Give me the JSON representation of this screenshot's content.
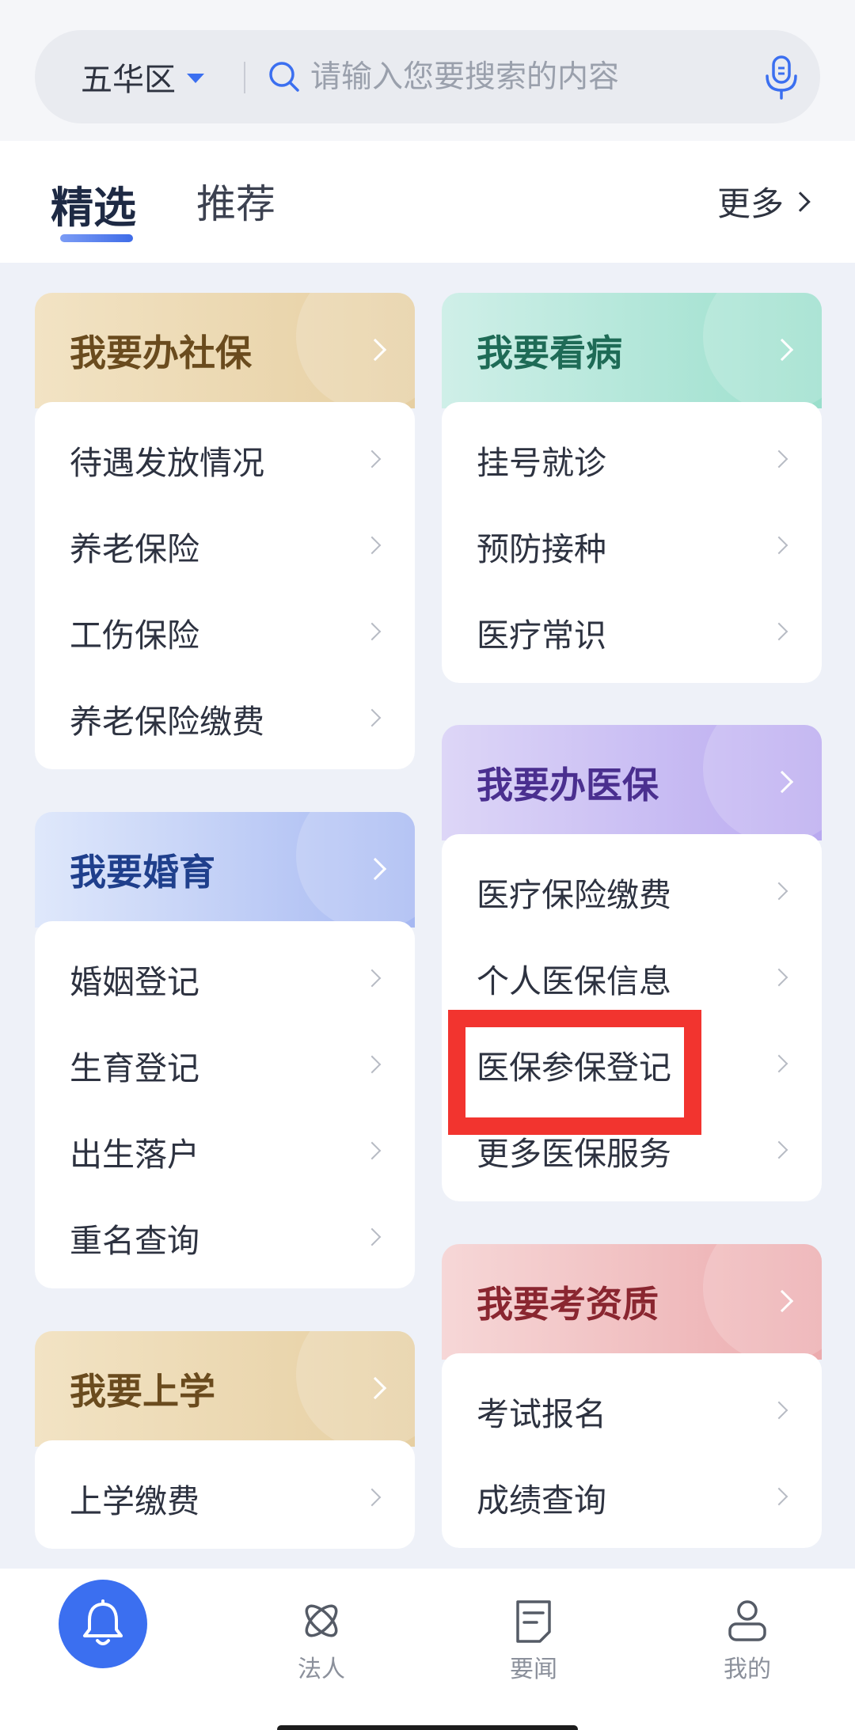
{
  "search": {
    "district": "五华区",
    "placeholder": "请输入您要搜索的内容"
  },
  "tabs": {
    "active": "精选",
    "second": "推荐",
    "more": "更多"
  },
  "cards": {
    "shebao": {
      "title": "我要办社保",
      "items": [
        "待遇发放情况",
        "养老保险",
        "工伤保险",
        "养老保险缴费"
      ]
    },
    "kanbing": {
      "title": "我要看病",
      "items": [
        "挂号就诊",
        "预防接种",
        "医疗常识"
      ]
    },
    "yibao": {
      "title": "我要办医保",
      "items": [
        "医疗保险缴费",
        "个人医保信息",
        "医保参保登记",
        "更多医保服务"
      ]
    },
    "hunyu": {
      "title": "我要婚育",
      "items": [
        "婚姻登记",
        "生育登记",
        "出生落户",
        "重名查询"
      ]
    },
    "zizhi": {
      "title": "我要考资质",
      "items": [
        "考试报名",
        "成绩查询"
      ]
    },
    "shangxue": {
      "title": "我要上学",
      "items": [
        "上学缴费"
      ]
    }
  },
  "nav": {
    "items": [
      "法人",
      "要闻",
      "我的"
    ]
  },
  "colors": {
    "accent": "#3b6ff0",
    "highlight": "#f2342f"
  }
}
